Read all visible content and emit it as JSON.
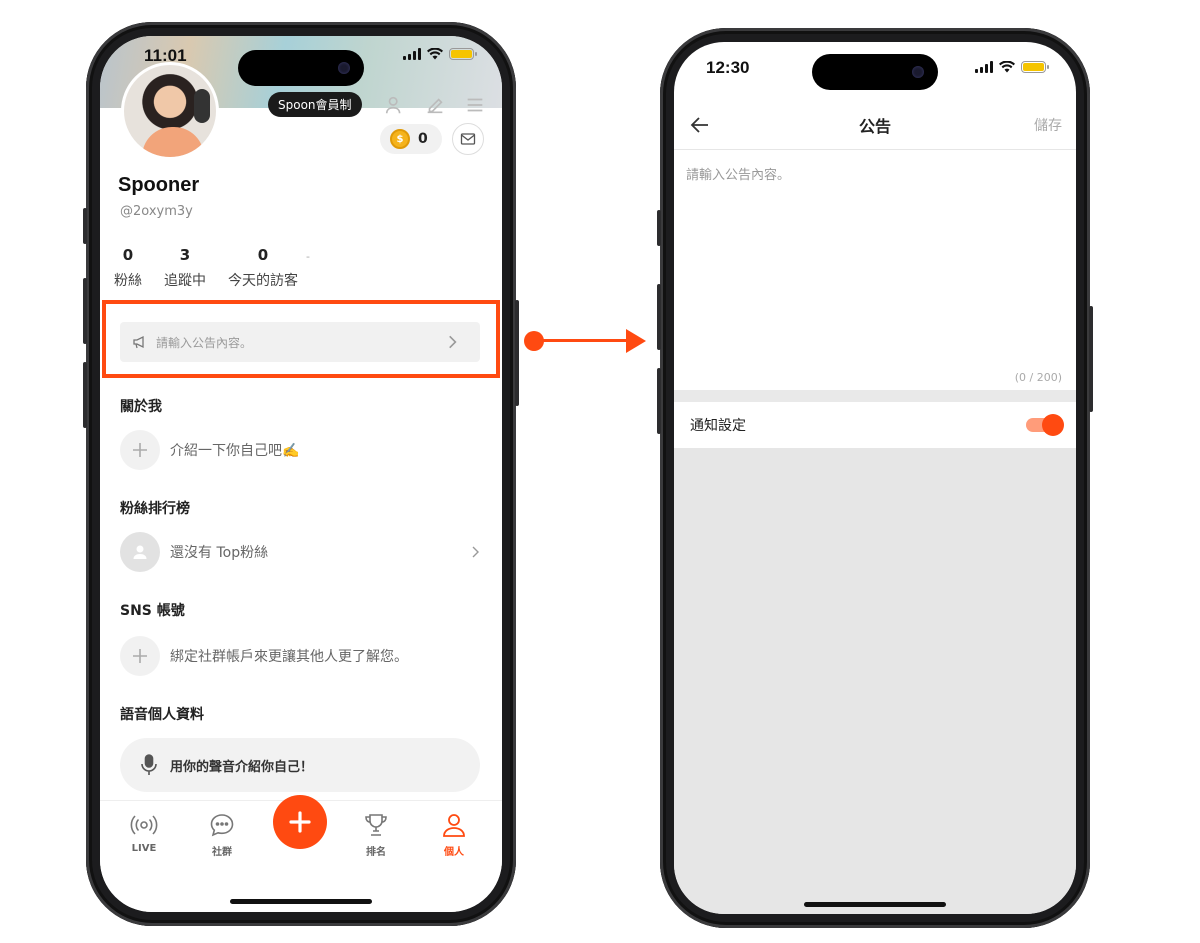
{
  "left_phone": {
    "status_time": "11:01",
    "tooltip": "Spoon會員制",
    "coin_count": "0",
    "profile": {
      "name": "Spooner",
      "handle": "@2oxym3y"
    },
    "stats": [
      {
        "value": "0",
        "label": "粉絲"
      },
      {
        "value": "3",
        "label": "追蹤中"
      },
      {
        "value": "0",
        "label": "今天的訪客",
        "suffix": "-"
      }
    ],
    "notice_placeholder": "請輸入公告內容。",
    "sections": {
      "about": {
        "title": "關於我",
        "text": "介紹一下你自己吧✍️"
      },
      "fans": {
        "title": "粉絲排行榜",
        "text": "還沒有 Top粉絲"
      },
      "sns": {
        "title": "SNS 帳號",
        "text": "綁定社群帳戶來更讓其他人更了解您。"
      },
      "voice": {
        "title": "語音個人資料",
        "text": "用你的聲音介紹你自己！"
      }
    },
    "tabs": [
      {
        "label": "LIVE",
        "icon": "broadcast-icon"
      },
      {
        "label": "社群",
        "icon": "chat-bubble-icon"
      },
      {
        "label": "",
        "icon": "plus-icon"
      },
      {
        "label": "排名",
        "icon": "trophy-icon"
      },
      {
        "label": "個人",
        "icon": "person-icon"
      }
    ],
    "accent_color": "#ff4a11"
  },
  "right_phone": {
    "status_time": "12:30",
    "title": "公告",
    "save_label": "儲存",
    "input_placeholder": "請輸入公告內容。",
    "counter": "(0 / 200)",
    "setting_label": "通知設定",
    "toggle_on": true
  }
}
